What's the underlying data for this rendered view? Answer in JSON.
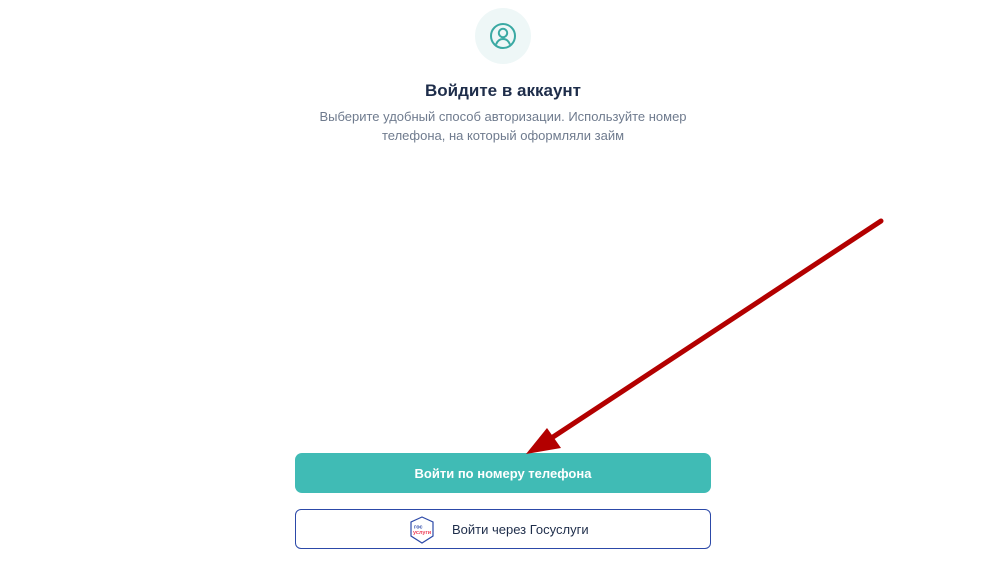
{
  "header": {
    "avatar_icon": "user-icon",
    "title": "Войдите в аккаунт",
    "subtitle": "Выберите удобный способ авторизации. Используйте номер телефона, на который оформляли займ"
  },
  "actions": {
    "phone_login_label": "Войти по номеру телефона",
    "gosuslugi_login_label": "Войти через Госуслуги",
    "gosuslugi_logo": {
      "icon": "gosuslugi-logo",
      "text_top": "гос",
      "text_bottom": "услуги"
    }
  },
  "colors": {
    "accent": "#40bbb5",
    "title": "#1e2d4a",
    "subtitle": "#6f7b8e",
    "gos_blue": "#2c49a8",
    "gos_red": "#ee3f58",
    "annotation_arrow": "#b30000"
  }
}
